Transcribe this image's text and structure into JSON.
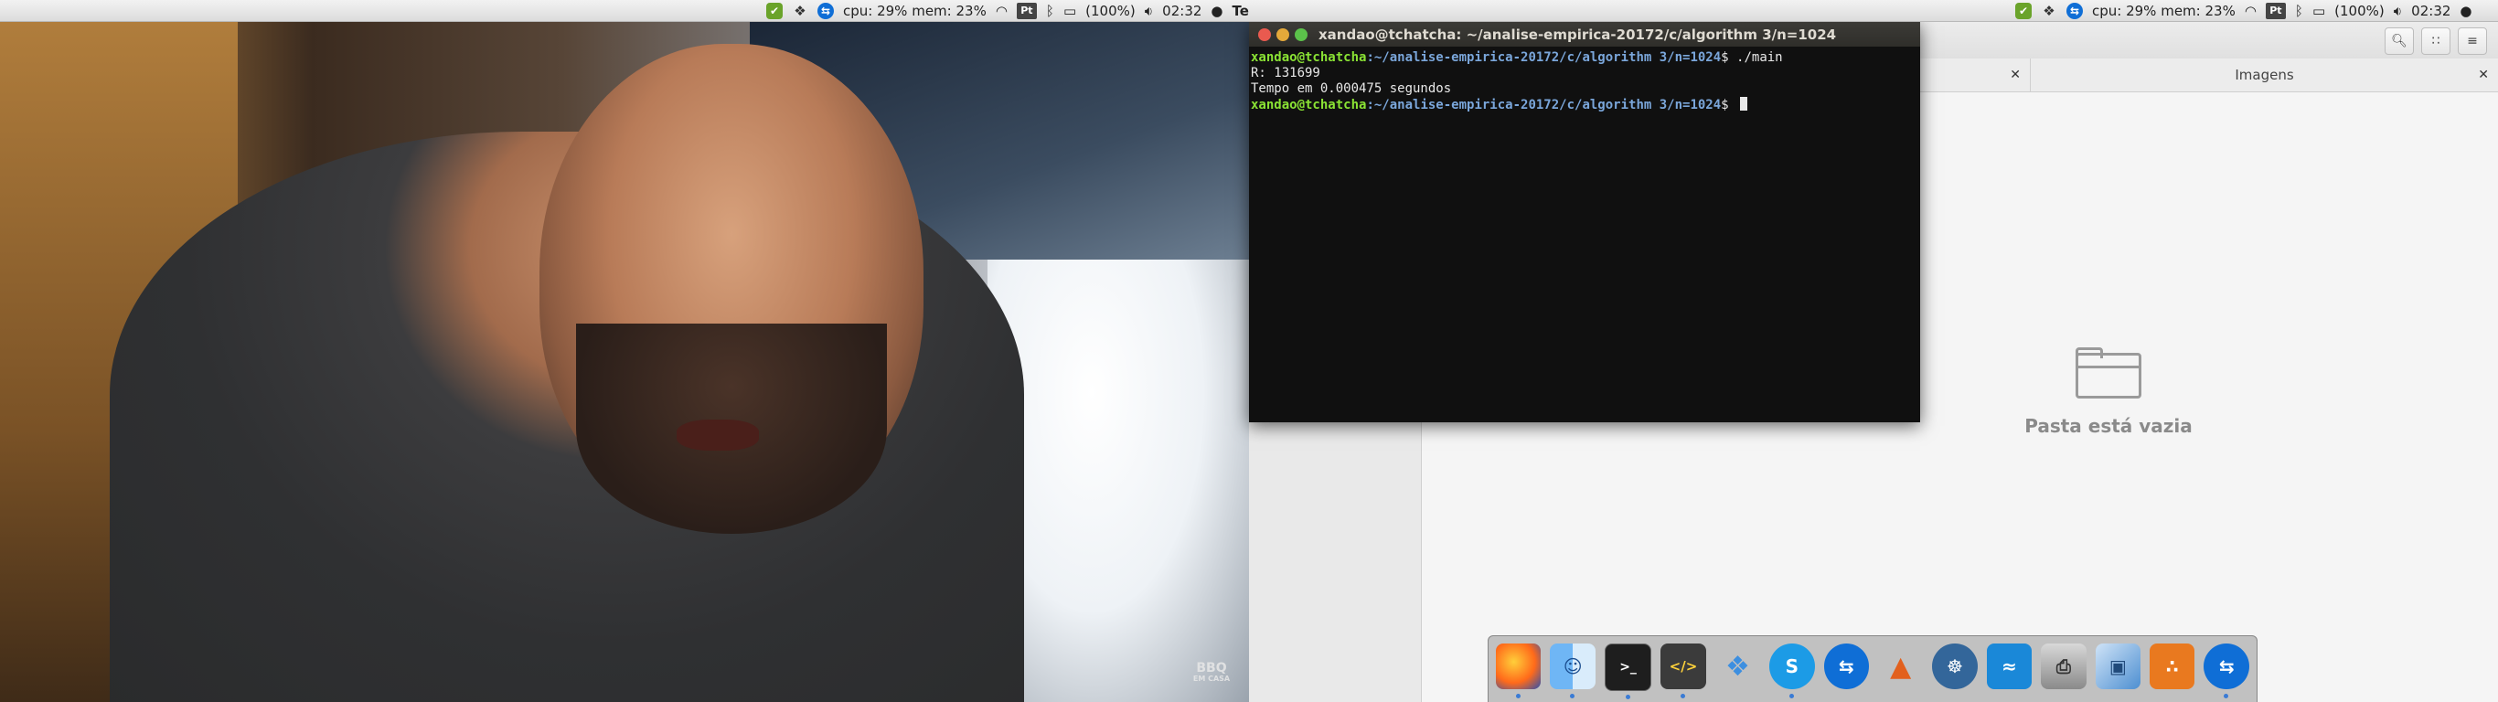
{
  "topbar_left": {
    "cpu_mem": "cpu: 29% mem: 23%",
    "pt_label": "Pt",
    "battery": "(100%)",
    "time": "02:32",
    "app_name": "Terminal"
  },
  "topbar_right": {
    "cpu_mem": "cpu: 29% mem: 23%",
    "pt_label": "Pt",
    "battery": "(100%)",
    "time": "02:32"
  },
  "video": {
    "watermark_line1": "BBQ",
    "watermark_line2": "EM CASA"
  },
  "terminal": {
    "title": "xandao@tchatcha: ~/analise-empirica-20172/c/algorithm 3/n=1024",
    "lines": [
      {
        "user": "xandao@tchatcha",
        "path": ":~/analise-empirica-20172/c/algorithm 3/n=1024",
        "cmd": "$ ./main"
      },
      {
        "text": "R: 131699"
      },
      {
        "text": "Tempo em 0.000475 segundos"
      },
      {
        "user": "xandao@tchatcha",
        "path": ":~/analise-empirica-20172/c/algorithm 3/n=1024",
        "cmd": "$ "
      }
    ]
  },
  "file_manager": {
    "tab_title": "Imagens",
    "empty_text": "Pasta está vazia",
    "close_symbol": "✕"
  },
  "dock": {
    "items": [
      "firefox-icon",
      "finder-icon",
      "terminal-icon",
      "code-editor-icon",
      "dropbox-icon",
      "skype-icon",
      "teamviewer-icon",
      "matlab-icon",
      "postgresql-icon",
      "mysql-workbench-icon",
      "scanner-icon",
      "virtualbox-icon",
      "network-tool-icon",
      "teamviewer-icon-2"
    ]
  },
  "colors": {
    "terminal_user": "#8ae234",
    "terminal_path": "#7aa6da",
    "terminal_bg": "#101010"
  }
}
